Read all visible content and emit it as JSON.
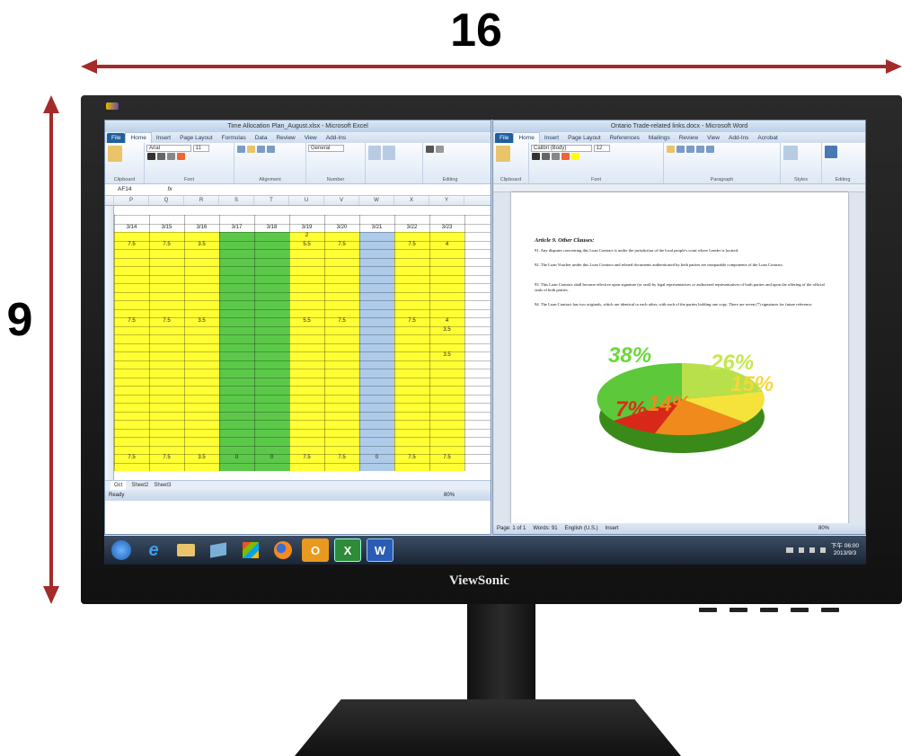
{
  "dimensions": {
    "width_label": "16",
    "height_label": "9",
    "arrow_color": "#a52a2a"
  },
  "monitor": {
    "brand": "ViewSonic"
  },
  "excel": {
    "title": "Time Allocation Plan_August.xlsx - Microsoft Excel",
    "tabs": [
      "File",
      "Home",
      "Insert",
      "Page Layout",
      "Formulas",
      "Data",
      "Review",
      "View",
      "Add-Ins"
    ],
    "ribbon_groups": [
      "Clipboard",
      "Font",
      "Alignment",
      "Number",
      "Editing"
    ],
    "font_box": "Arial",
    "font_size": "11",
    "number_format": "General",
    "name_box": "AF14",
    "formula_label": "fx",
    "columns": [
      "P",
      "Q",
      "R",
      "S",
      "T",
      "U",
      "V",
      "W",
      "X",
      "Y"
    ],
    "dates": [
      "3/14",
      "3/15",
      "3/16",
      "3/17",
      "3/18",
      "3/19",
      "3/20",
      "3/21",
      "3/22",
      "3/23"
    ],
    "row4_values": [
      "7.5",
      "7.5",
      "3.5",
      "",
      "",
      "5.5",
      "7.5",
      "",
      "7.5",
      "4"
    ],
    "row13_values": [
      "7.5",
      "7.5",
      "3.5",
      "",
      "",
      "5.5",
      "7.5",
      "",
      "7.5",
      "4"
    ],
    "total_values": [
      "7.5",
      "7.5",
      "3.5",
      "0",
      "0",
      "7.5",
      "7.5",
      "0",
      "7.5",
      "7.5"
    ],
    "extra_cells": {
      "u3": "2",
      "y14": "3.5",
      "y17": "3.5"
    },
    "sheet_tabs": [
      "Oct",
      "Sheet2",
      "Sheet3"
    ],
    "status": "Ready",
    "zoom": "80%"
  },
  "word": {
    "title": "Ontario Trade-related links.docx - Microsoft Word",
    "tabs": [
      "File",
      "Home",
      "Insert",
      "Page Layout",
      "References",
      "Mailings",
      "Review",
      "View",
      "Add-Ins",
      "Acrobat"
    ],
    "font_box": "Calibri (Body)",
    "font_size": "12",
    "ribbon_groups": [
      "Clipboard",
      "Font",
      "Paragraph",
      "Styles",
      "Editing"
    ],
    "doc_title": "Article 9. Other Clauses:",
    "paragraphs": [
      "91. Any disputes concerning this Loan Contract is under the jurisdiction of the local people's court where Lender is located.",
      "92. The Loan Voucher under this Loan Contract and related documents authenticated by both parties are inseparable components of the Loan Contract.",
      "93. This Loan Contract shall become effective upon signature (or seal) by legal representatives or authorized representatives of both parties and upon the offering of the official seals of both parties.",
      "94. The Loan Contract has two originals, which are identical to each other, with each of the parties holding one copy. There are seven (7) signatures for future reference."
    ],
    "pie_labels": [
      "38%",
      "26%",
      "15%",
      "7%",
      "14%"
    ],
    "status_page": "Page: 1 of 1",
    "status_words": "Words: 91",
    "status_lang": "English (U.S.)",
    "status_mode": "Insert",
    "zoom": "80%"
  },
  "taskbar": {
    "apps": [
      "start-orb",
      "ie",
      "explorer",
      "media",
      "windows-media",
      "firefox",
      "outlook",
      "excel",
      "word"
    ],
    "excel_glyph": "X",
    "word_glyph": "W",
    "outlook_glyph": "O",
    "clock_time": "下午 06:00",
    "clock_date": "2013/9/3"
  },
  "colors": {
    "yellow": "#ffff33",
    "green": "#5cc84a",
    "blue": "#aecbea",
    "ribbon": "#dde8f5"
  }
}
